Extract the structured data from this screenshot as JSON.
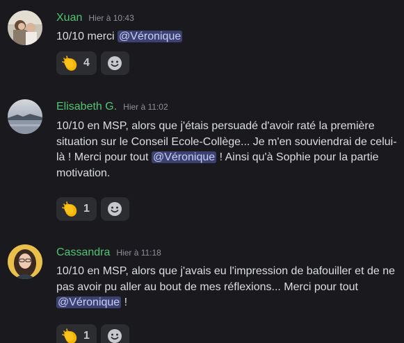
{
  "messages": [
    {
      "author": "Xuan",
      "timestamp": "Hier à 10:43",
      "text_before": "10/10 merci ",
      "mention": "@Véronique",
      "text_after": "",
      "reaction": {
        "emoji": "clap-emoji",
        "count": "4"
      },
      "author_color": "#52c373"
    },
    {
      "author": "Elisabeth G.",
      "timestamp": "Hier à 11:02",
      "text_before": "10/10 en MSP, alors que j'étais persuadé d'avoir raté la première situation sur le Conseil Ecole-Collège... Je m'en souviendrai de celui-là ! Merci pour tout ",
      "mention": "@Véronique",
      "text_after": " ! Ainsi qu'à Sophie pour la partie motivation.",
      "reaction": {
        "emoji": "clap-emoji",
        "count": "1"
      },
      "author_color": "#52c373"
    },
    {
      "author": "Cassandra",
      "timestamp": "Hier à 11:18",
      "text_before": "10/10 en MSP, alors que j'avais eu l'impression de bafouiller et de ne pas avoir pu aller au bout de mes réflexions... Merci pour tout ",
      "mention": "@Véronique",
      "text_after": " !",
      "reaction": {
        "emoji": "clap-emoji",
        "count": "1"
      },
      "author_color": "#52c373"
    }
  ],
  "add_reaction_icon": "smiley-add-reaction-icon",
  "colors": {
    "background": "#1a1a1e",
    "text": "#dbdee1",
    "mention_bg": "#3c4270",
    "mention_text": "#c9cdfb",
    "reaction_bg": "#2b2d31"
  }
}
